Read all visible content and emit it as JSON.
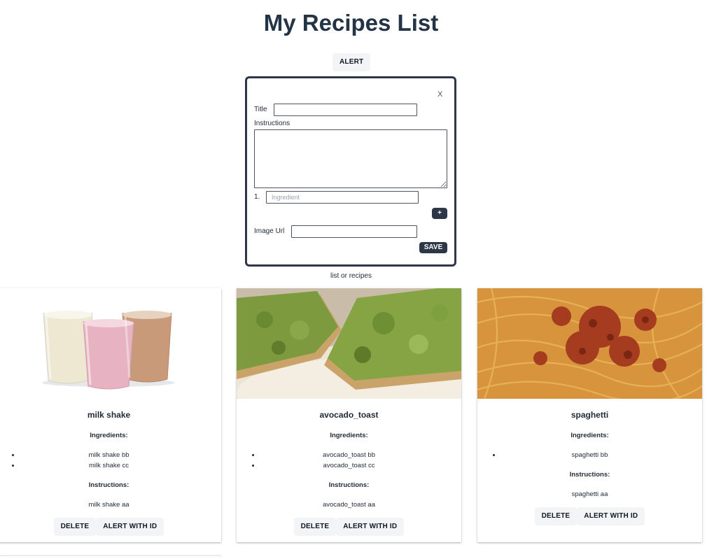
{
  "page": {
    "title": "My Recipes List",
    "alert_button": "ALERT"
  },
  "form": {
    "close_label": "X",
    "title_label": "Title",
    "title_value": "",
    "instructions_label": "Instructions",
    "instructions_value": "",
    "ingredient_number": "1.",
    "ingredient_placeholder": "Ingredient",
    "add_button": "+",
    "image_url_label": "Image Url",
    "image_url_value": "",
    "save_button": "SAVE"
  },
  "list_caption": "list or recipes",
  "colors": {
    "dark": "#2d3748",
    "button_bg": "#f3f4f6",
    "title": "#243447"
  },
  "recipes": [
    {
      "title": "milk shake",
      "image_icon": "milkshake-photo",
      "ingredients_label": "Ingredients:",
      "ingredients": [
        "milk shake bb",
        "milk shake cc"
      ],
      "instructions_label": "Instructions:",
      "instructions": "milk shake aa",
      "delete_label": "DELETE",
      "alert_label": "ALERT WITH ID"
    },
    {
      "title": "avocado_toast",
      "image_icon": "avocado-toast-photo",
      "ingredients_label": "Ingredients:",
      "ingredients": [
        "avocado_toast bb",
        "avocado_toast cc"
      ],
      "instructions_label": "Instructions:",
      "instructions": "avocado_toast aa",
      "delete_label": "DELETE",
      "alert_label": "ALERT WITH ID"
    },
    {
      "title": "spaghetti",
      "image_icon": "spaghetti-photo",
      "ingredients_label": "Ingredients:",
      "ingredients": [
        "spaghetti bb"
      ],
      "instructions_label": "Instructions:",
      "instructions": "spaghetti aa",
      "delete_label": "DELETE",
      "alert_label": "ALERT WITH ID"
    }
  ]
}
